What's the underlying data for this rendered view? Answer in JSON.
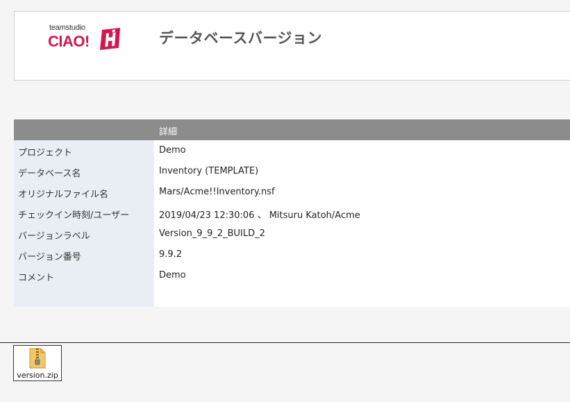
{
  "logo": {
    "small_text": "teamstudio",
    "big_text": "CIAO!",
    "brand_color": "#d1174e"
  },
  "header": {
    "title": "データベースバージョン"
  },
  "details": {
    "heading": "詳細",
    "rows": [
      {
        "label": "プロジェクト",
        "value": "Demo"
      },
      {
        "label": "データベース名",
        "value": "Inventory (TEMPLATE)"
      },
      {
        "label": "オリジナルファイル名",
        "value": "Mars/Acme!!Inventory.nsf"
      },
      {
        "label": "チェックイン時刻/ユーザー",
        "value": "2019/04/23 12:30:06 、 Mitsuru Katoh/Acme"
      },
      {
        "label": "バージョンラベル",
        "value": "Version_9_9_2_BUILD_2"
      },
      {
        "label": "バージョン番号",
        "value": "9.9.2"
      },
      {
        "label": "コメント",
        "value": "Demo"
      }
    ]
  },
  "attachment": {
    "filename": "version.zip",
    "icon": "zip-file-icon"
  }
}
